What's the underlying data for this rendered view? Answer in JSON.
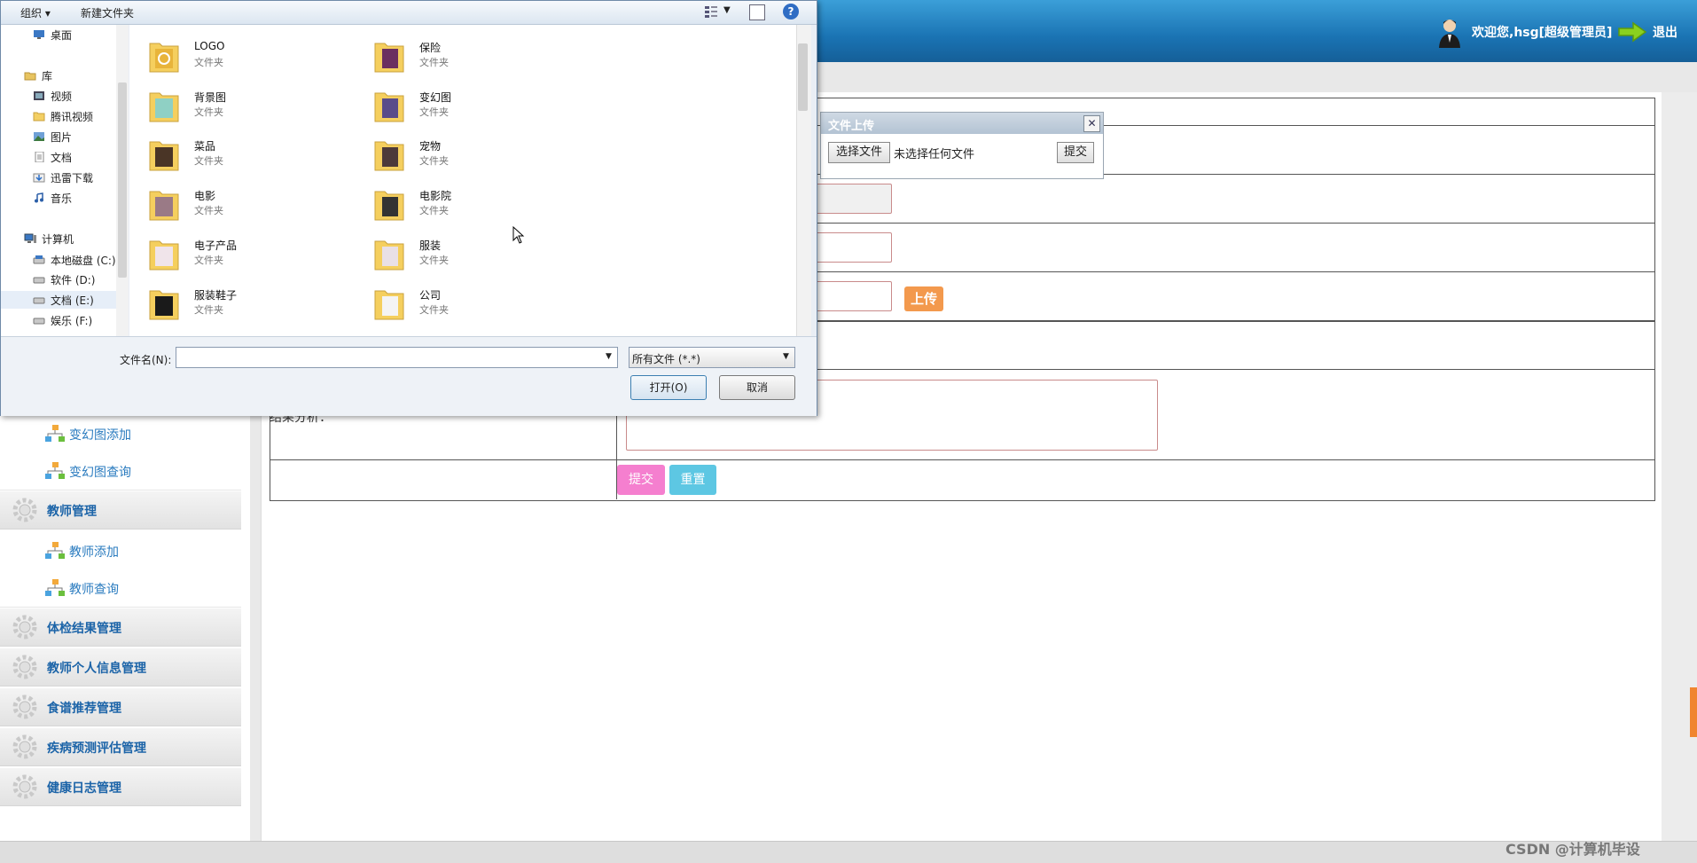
{
  "header": {
    "welcome": "欢迎您,hsg[超级管理员]",
    "logout": "退出"
  },
  "sidebar": {
    "items": [
      {
        "label": "变幻图添加",
        "kind": "sub"
      },
      {
        "label": "变幻图查询",
        "kind": "sub"
      },
      {
        "label": "教师管理",
        "kind": "group"
      },
      {
        "label": "教师添加",
        "kind": "sub"
      },
      {
        "label": "教师查询",
        "kind": "sub"
      },
      {
        "label": "体检结果管理",
        "kind": "group"
      },
      {
        "label": "教师个人信息管理",
        "kind": "group"
      },
      {
        "label": "食谱推荐管理",
        "kind": "group"
      },
      {
        "label": "疾病预测评估管理",
        "kind": "group"
      },
      {
        "label": "健康日志管理",
        "kind": "group"
      }
    ]
  },
  "form": {
    "upload_label": "上传",
    "result_label": "结果分析：",
    "submit": "提交",
    "reset": "重置"
  },
  "upload_popup": {
    "title": "文件上传",
    "choose": "选择文件",
    "no_file": "未选择任何文件",
    "submit": "提交",
    "close": "✕"
  },
  "dialog": {
    "toolbar": {
      "organize": "组织 ▾",
      "new_folder": "新建文件夹",
      "help": "?"
    },
    "nav": [
      {
        "label": "桌面",
        "icon": "desktop-icon"
      },
      {
        "label": "库",
        "icon": "library-icon"
      },
      {
        "label": "视频",
        "icon": "video-icon"
      },
      {
        "label": "腾讯视频",
        "icon": "folder-icon"
      },
      {
        "label": "图片",
        "icon": "picture-icon"
      },
      {
        "label": "文档",
        "icon": "document-icon"
      },
      {
        "label": "迅雷下载",
        "icon": "download-icon"
      },
      {
        "label": "音乐",
        "icon": "music-icon"
      },
      {
        "label": "计算机",
        "icon": "computer-icon"
      },
      {
        "label": "本地磁盘 (C:)",
        "icon": "drive-icon"
      },
      {
        "label": "软件 (D:)",
        "icon": "drive-icon"
      },
      {
        "label": "文档 (E:)",
        "icon": "drive-icon"
      },
      {
        "label": "娱乐 (F:)",
        "icon": "drive-icon"
      }
    ],
    "files": [
      {
        "name": "LOGO",
        "type": "文件夹"
      },
      {
        "name": "保险",
        "type": "文件夹"
      },
      {
        "name": "背景图",
        "type": "文件夹"
      },
      {
        "name": "变幻图",
        "type": "文件夹"
      },
      {
        "name": "菜品",
        "type": "文件夹"
      },
      {
        "name": "宠物",
        "type": "文件夹"
      },
      {
        "name": "电影",
        "type": "文件夹"
      },
      {
        "name": "电影院",
        "type": "文件夹"
      },
      {
        "name": "电子产品",
        "type": "文件夹"
      },
      {
        "name": "服装",
        "type": "文件夹"
      },
      {
        "name": "服装鞋子",
        "type": "文件夹"
      },
      {
        "name": "公司",
        "type": "文件夹"
      }
    ],
    "filename_label": "文件名(N):",
    "filename_value": "",
    "filetype": "所有文件 (*.*)",
    "open": "打开(O)",
    "cancel": "取消"
  },
  "watermark": "CSDN @计算机毕设"
}
